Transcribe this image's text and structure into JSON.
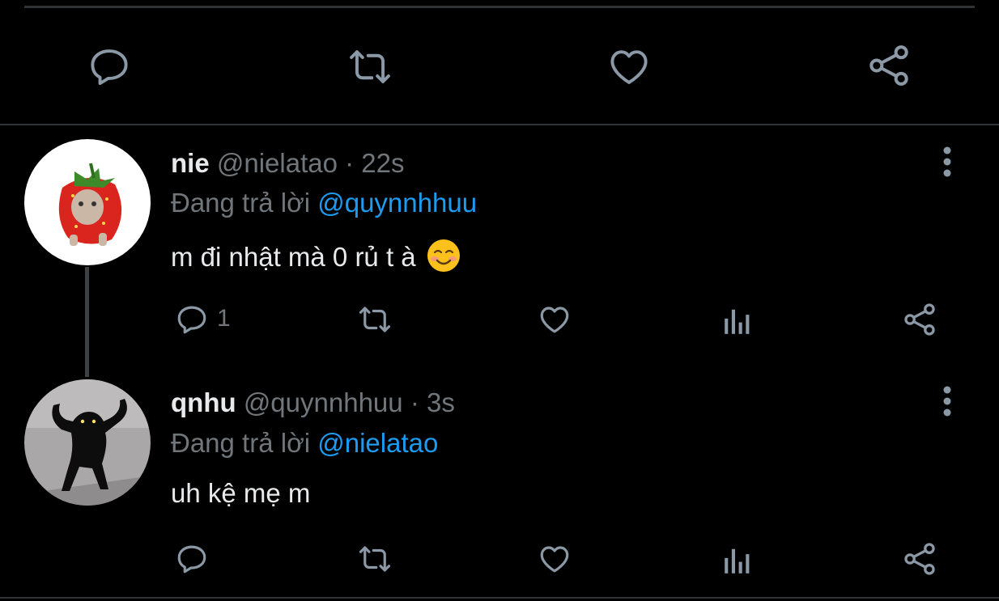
{
  "tweets": [
    {
      "display_name": "nie",
      "handle": "@nielatao",
      "time": "· 22s",
      "replying_prefix": "Đang trả lời",
      "replying_to": "@quynnhhuu",
      "text": "m đi nhật mà 0 rủ t à",
      "emoji": "smiling-blush-emoji",
      "reply_count": "1",
      "avatar": "strawberry-cat-avatar"
    },
    {
      "display_name": "qnhu",
      "handle": "@quynnhhuu",
      "time": "· 3s",
      "replying_prefix": "Đang trả lời",
      "replying_to": "@nielatao",
      "text": "uh kệ mẹ m",
      "reply_count": "",
      "avatar": "black-cat-avatar"
    }
  ],
  "icons": {
    "reply": "reply-icon",
    "retweet": "retweet-icon",
    "like": "like-icon",
    "views": "views-icon",
    "share": "share-icon",
    "more": "more-icon"
  },
  "colors": {
    "background": "#000000",
    "primary_text": "#e7e9ea",
    "secondary_text": "#71767b",
    "accent": "#1d9bf0",
    "divider": "#2f3336"
  }
}
